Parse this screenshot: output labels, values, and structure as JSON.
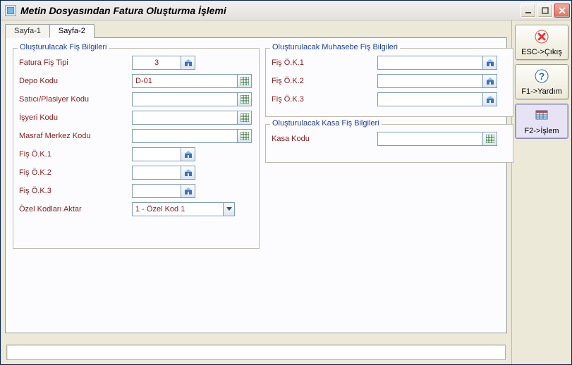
{
  "window": {
    "title": "Metin Dosyasından Fatura Oluşturma İşlemi"
  },
  "tabs": {
    "tab1": "Sayfa-1",
    "tab2": "Sayfa-2",
    "active": 2
  },
  "group_left": {
    "legend": "Oluşturulacak Fiş Bilgileri",
    "fatura_tipi_label": "Fatura Fiş Tipi",
    "fatura_tipi_value": "3",
    "depo_label": "Depo Kodu",
    "depo_value": "D-01",
    "satici_label": "Satıcı/Plasiyer Kodu",
    "satici_value": "",
    "isyeri_label": "İşyeri Kodu",
    "isyeri_value": "",
    "masraf_label": "Masraf Merkez Kodu",
    "masraf_value": "",
    "ok1_label": "Fiş Ö.K.1",
    "ok1_value": "",
    "ok2_label": "Fiş Ö.K.2",
    "ok2_value": "",
    "ok3_label": "Fiş Ö.K.3",
    "ok3_value": "",
    "ozel_label": "Özel Kodları Aktar",
    "ozel_value": "1 - Özel Kod 1"
  },
  "group_muh": {
    "legend": "Oluşturulacak Muhasebe Fiş Bilgileri",
    "ok1_label": "Fiş Ö.K.1",
    "ok1_value": "",
    "ok2_label": "Fiş Ö.K.2",
    "ok2_value": "",
    "ok3_label": "Fiş Ö.K.3",
    "ok3_value": ""
  },
  "group_kasa": {
    "legend": "Oluşturulacak Kasa Fiş Bilgileri",
    "kasa_label": "Kasa Kodu",
    "kasa_value": ""
  },
  "sidebar": {
    "esc_label": "ESC->Çıkış",
    "f1_label": "F1->Yardım",
    "f2_label": "F2->İşlem"
  }
}
